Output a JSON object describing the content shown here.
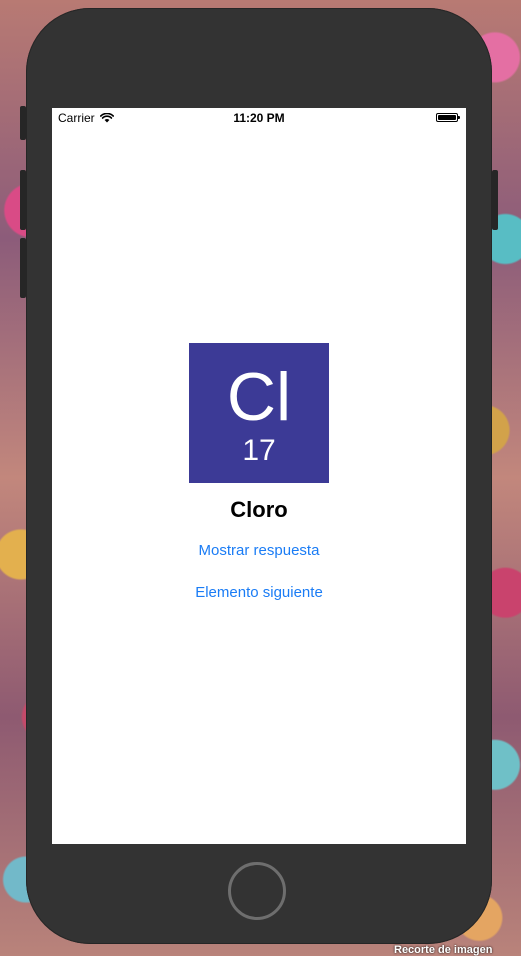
{
  "status_bar": {
    "carrier": "Carrier",
    "time": "11:20 PM",
    "wifi_icon": "wifi-icon",
    "battery_icon": "battery-icon"
  },
  "element": {
    "symbol": "Cl",
    "number": "17",
    "name": "Cloro",
    "tile_color": "#3c3a96"
  },
  "actions": {
    "show_answer_label": "Mostrar respuesta",
    "next_element_label": "Elemento siguiente",
    "link_color": "#1a7cf5"
  },
  "caption": "Recorte de imagen"
}
